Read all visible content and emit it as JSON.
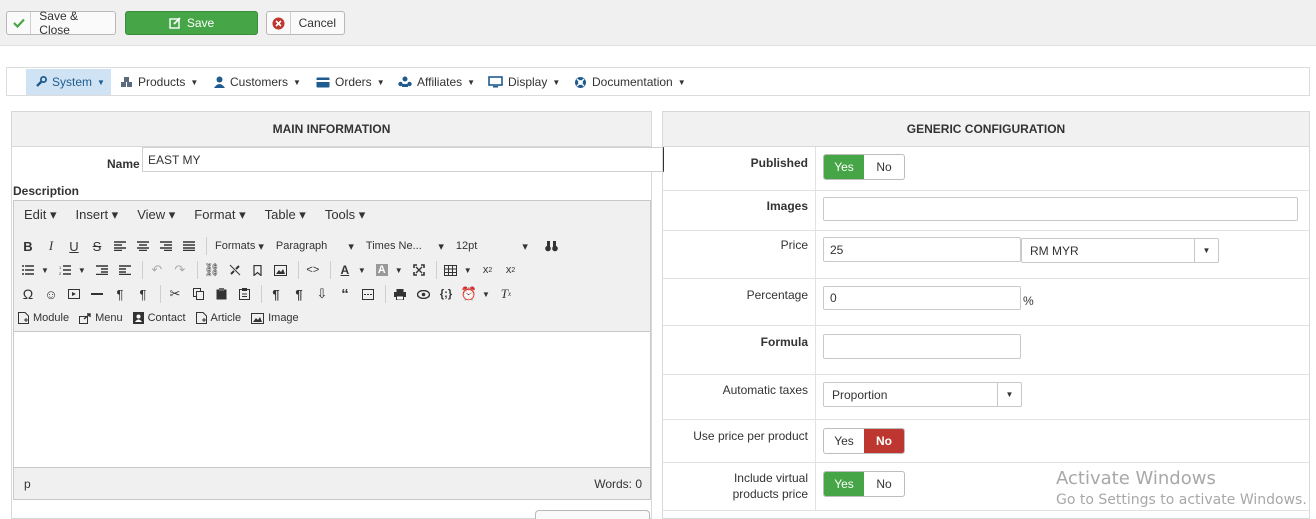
{
  "toolbar": {
    "save_close_label": "Save & Close",
    "save_label": "Save",
    "cancel_label": "Cancel"
  },
  "nav": {
    "items": [
      {
        "label": "System",
        "icon": "wrench-icon"
      },
      {
        "label": "Products",
        "icon": "cubes-icon"
      },
      {
        "label": "Customers",
        "icon": "user-icon"
      },
      {
        "label": "Orders",
        "icon": "credit-card-icon"
      },
      {
        "label": "Affiliates",
        "icon": "network-icon"
      },
      {
        "label": "Display",
        "icon": "monitor-icon"
      },
      {
        "label": "Documentation",
        "icon": "lifebuoy-icon"
      }
    ]
  },
  "main_info": {
    "title": "MAIN INFORMATION",
    "name_label": "Name",
    "name_value": "EAST MY",
    "description_label": "Description",
    "editor": {
      "menus": [
        "Edit",
        "Insert",
        "View",
        "Format",
        "Table",
        "Tools"
      ],
      "formats": "Formats",
      "block": "Paragraph",
      "font": "Times Ne...",
      "size": "12pt",
      "insert_buttons": [
        "Module",
        "Menu",
        "Contact",
        "Article",
        "Image"
      ],
      "path": "p",
      "words": "Words: 0"
    }
  },
  "generic": {
    "title": "GENERIC CONFIGURATION",
    "published_label": "Published",
    "yes": "Yes",
    "no": "No",
    "images_label": "Images",
    "price_label": "Price",
    "price_value": "25",
    "currency": "RM MYR",
    "percentage_label": "Percentage",
    "percentage_value": "0",
    "percent_sign": "%",
    "formula_label": "Formula",
    "auto_taxes_label": "Automatic taxes",
    "auto_taxes_value": "Proportion",
    "use_price_label": "Use price per product",
    "include_virtual_label_1": "Include virtual",
    "include_virtual_label_2": "products price"
  },
  "watermark": {
    "line1": "Activate Windows",
    "line2": "Go to Settings to activate Windows."
  },
  "colors": {
    "green": "#46a546",
    "red": "#bd362f",
    "active_nav": "#cfe3f5"
  }
}
